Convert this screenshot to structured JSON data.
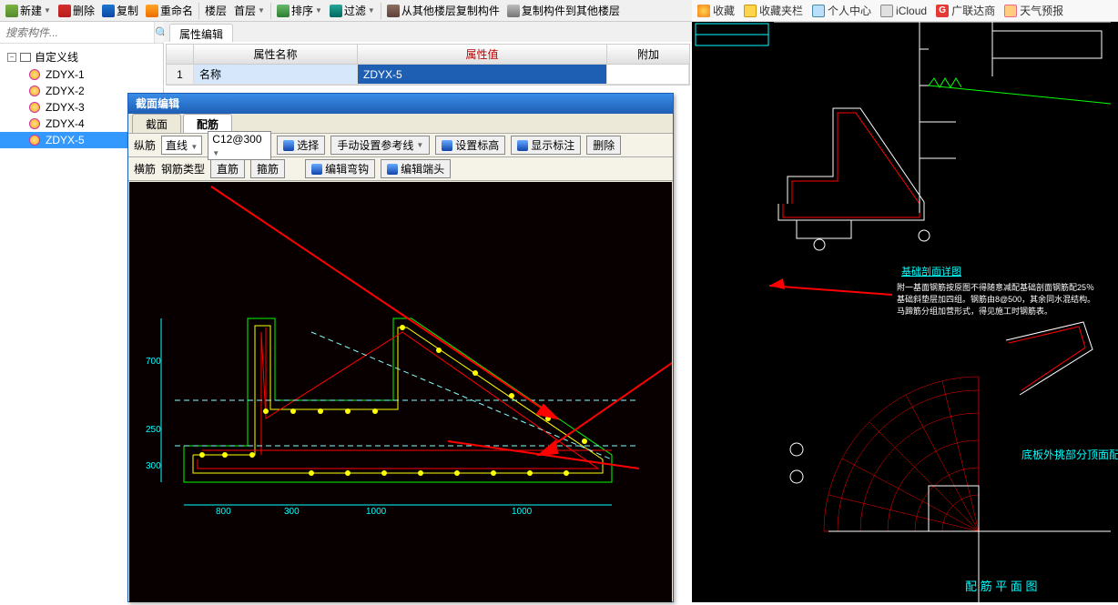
{
  "toolbar": {
    "new": "新建",
    "delete": "删除",
    "copy": "复制",
    "rename": "重命名",
    "floor": "楼层",
    "floor_val": "首层",
    "sort": "排序",
    "filter": "过滤",
    "copy_from": "从其他楼层复制构件",
    "copy_to": "复制构件到其他楼层"
  },
  "bookmarks": {
    "fav": "收藏",
    "folder": "收藏夹栏",
    "personal": "个人中心",
    "icloud": "iCloud",
    "glodon": "广联达商",
    "weather": "天气预报"
  },
  "search": {
    "placeholder": "搜索构件...",
    "icon": "🔍"
  },
  "tree": {
    "root": "自定义线",
    "items": [
      "ZDYX-1",
      "ZDYX-2",
      "ZDYX-3",
      "ZDYX-4",
      "ZDYX-5"
    ],
    "selected": 4
  },
  "prop": {
    "tab": "属性编辑",
    "headers": {
      "name": "属性名称",
      "value": "属性值",
      "extra": "附加"
    },
    "row1": {
      "idx": "1",
      "name": "名称",
      "val": "ZDYX-5"
    }
  },
  "dialog": {
    "title": "截面编辑",
    "tabs": [
      "截面",
      "配筋"
    ],
    "active_tab": 1,
    "row1": {
      "vbar": "纵筋",
      "line_type": "直线",
      "spec": "C12@300",
      "select": "选择",
      "manual": "手动设置参考线",
      "setel": "设置标高",
      "showel": "显示标注",
      "del": "删除"
    },
    "row2": {
      "hbar": "横筋",
      "bartype_lbl": "钢筋类型",
      "straight": "直筋",
      "hoop": "箍筋",
      "editbend": "编辑弯钩",
      "editend": "编辑端头"
    },
    "dims": {
      "d700": "700",
      "d250": "250",
      "d300": "300",
      "d800": "800",
      "d1000a": "1000",
      "d1000b": "1000"
    }
  },
  "right_cad": {
    "title1": "基础剖面详图",
    "note1": "附一基面钢筋按原图不得随意减配基础剖面钢筋配25％",
    "note2": "基础斜垫层加四组。钢筋由8@500，其余同水混结构。",
    "note3": "马蹄筋分组加营形式，得见施工时钢筋表。",
    "title2": "底板外挑部分顶面配筋图",
    "title3": "配 筋 平 面 图"
  }
}
